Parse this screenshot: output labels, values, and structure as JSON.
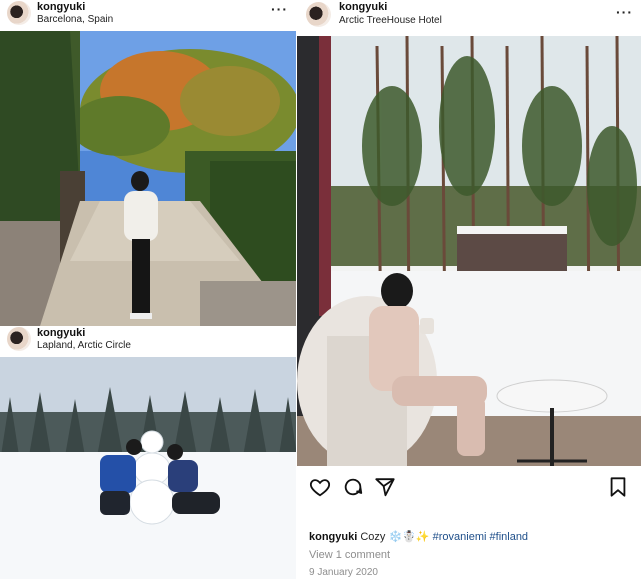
{
  "posts": [
    {
      "username": "kongyuki",
      "location": "Barcelona, Spain",
      "more": "···"
    },
    {
      "username": "kongyuki",
      "location": "Lapland, Arctic Circle",
      "more": "···"
    },
    {
      "username": "kongyuki",
      "location": "Arctic TreeHouse Hotel",
      "more": "···",
      "caption_user": "kongyuki",
      "caption_text": "Cozy",
      "caption_emoji": "❄️☃️✨",
      "hashtags": [
        "#rovaniemi",
        "#finland"
      ],
      "view_comments": "View 1 comment",
      "date": "9 January 2020"
    }
  ],
  "icons": [
    "heart-icon",
    "comment-icon",
    "share-icon",
    "bookmark-icon"
  ]
}
